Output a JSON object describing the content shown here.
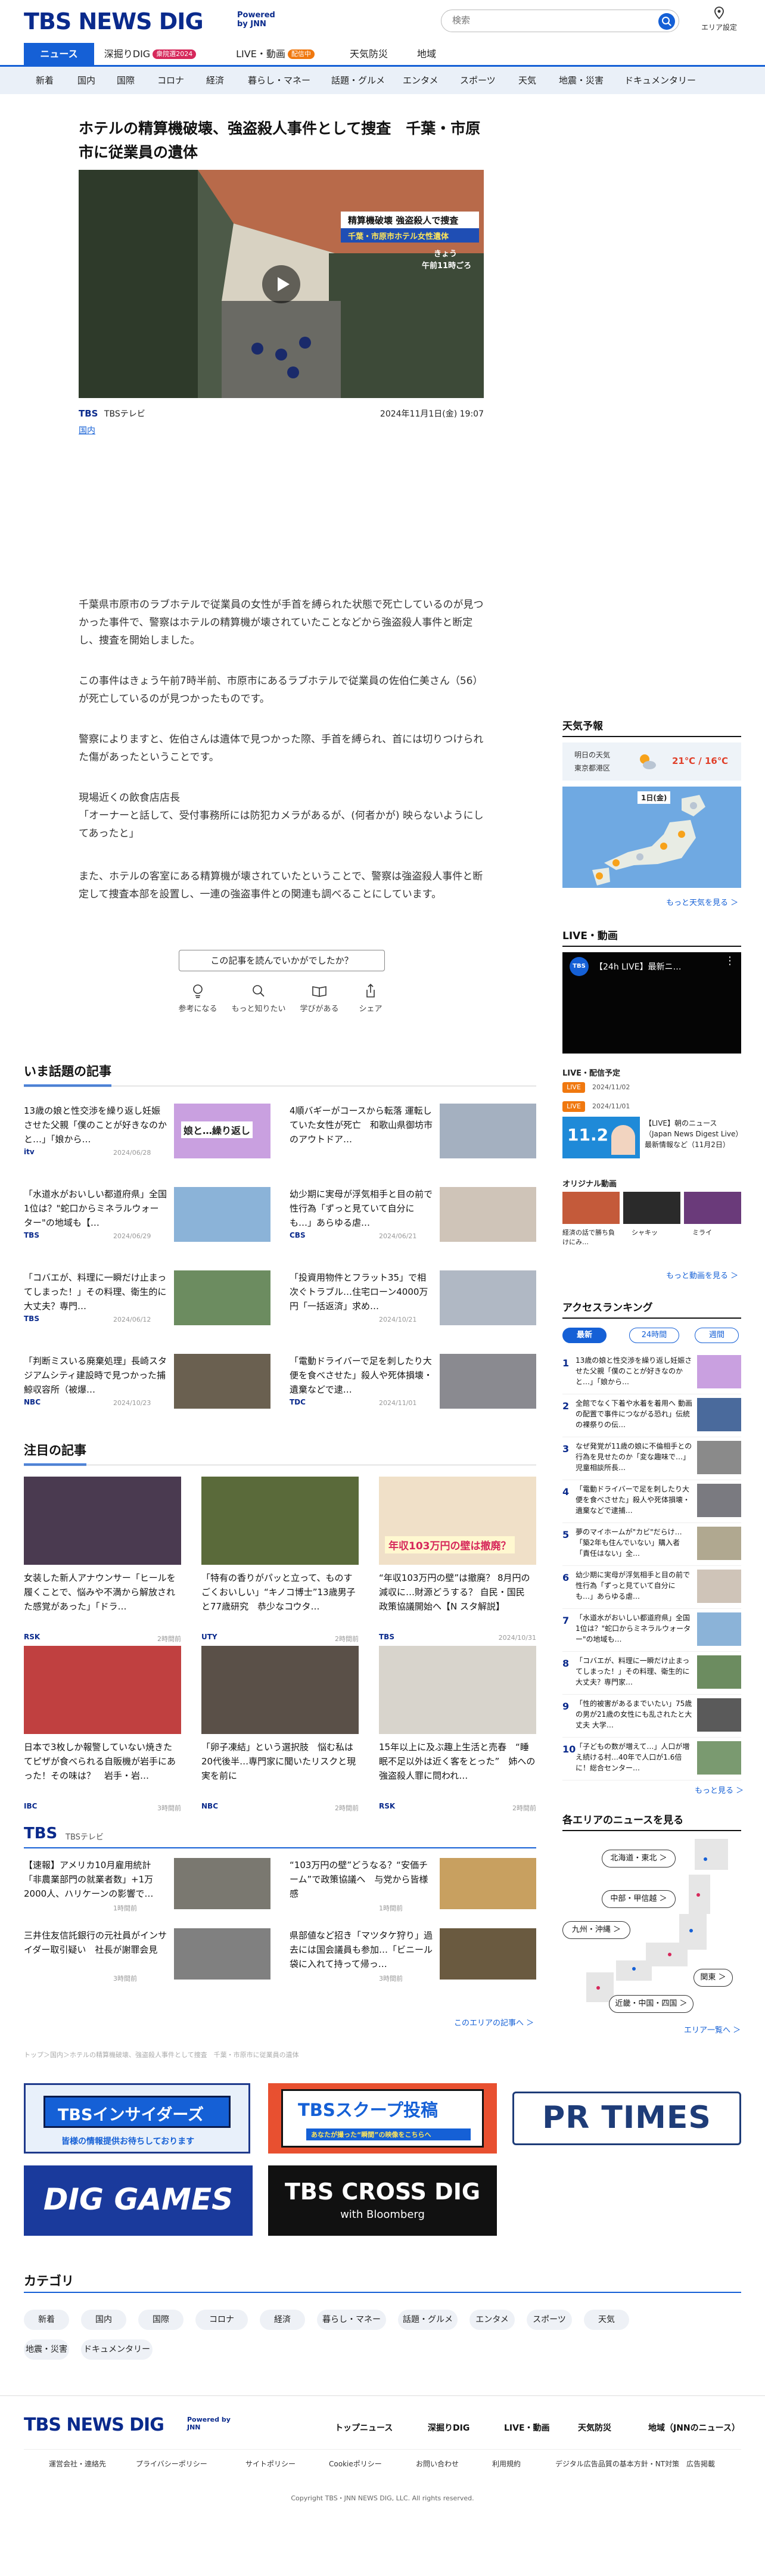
{
  "header": {
    "logo": "TBS NEWS DIG",
    "powered": "Powered by JNN",
    "search_placeholder": "検索",
    "area_setting": "エリア設定"
  },
  "global_nav": [
    {
      "label": "ニュース",
      "active": true
    },
    {
      "label": "深掘りDIG",
      "badge": "衆院選2024",
      "badge_color": "#d6285b"
    },
    {
      "label": "LIVE・動画",
      "badge": "配信中",
      "badge_color": "#f0780f"
    },
    {
      "label": "天気防災"
    },
    {
      "label": "地域"
    }
  ],
  "category_nav": [
    "新着",
    "国内",
    "国際",
    "コロナ",
    "経済",
    "暮らし・マネー",
    "話題・グルメ",
    "エンタメ",
    "スポーツ",
    "天気",
    "地震・災害",
    "ドキュメンタリー"
  ],
  "article": {
    "title": "ホテルの精算機破壊、強盗殺人事件として捜査　千葉・市原市に従業員の遺体",
    "hero_caption_1": "精算機破壊 強盗殺人で捜査",
    "hero_caption_2": "千葉・市原市ホテル女性遺体",
    "hero_caption_3": "きょう",
    "hero_caption_4": "午前11時ごろ",
    "source_mark": "TBS",
    "source": "TBSテレビ",
    "date": "2024年11月1日(金) 19:07",
    "category": "国内",
    "paragraphs": [
      "千葉県市原市のラブホテルで従業員の女性が手首を縛られた状態で死亡しているのが見つかった事件で、警察はホテルの精算機が壊されていたことなどから強盗殺人事件と断定し、捜査を開始しました。",
      "この事件はきょう午前7時半前、市原市にあるラブホテルで従業員の佐伯仁美さん（56）が死亡しているのが見つかったものです。",
      "警察によりますと、佐伯さんは遺体で見つかった際、手首を縛られ、首には切りつけられた傷があったということです。",
      "現場近くの飲食店店長\n「オーナーと話して、受付事務所には防犯カメラがあるが、(何者かが) 映らないようにしてあったと」",
      "また、ホテルの客室にある精算機が壊されていたということで、警察は強盗殺人事件と断定して捜査本部を設置し、一連の強盗事件との関連も調べることにしています。"
    ],
    "feedback_prompt": "この記事を読んでいかがでしたか？",
    "reactions": [
      "参考になる",
      "もっと知りたい",
      "学びがある",
      "シェア"
    ]
  },
  "trending": {
    "heading": "いま話題の記事",
    "items": [
      {
        "title": "13歳の娘と性交渉を繰り返し妊娠させた父親「僕のことが好きなのかと…」「娘から…",
        "source": "itv",
        "date": "2024/06/28",
        "thumb": "#c9a0e0",
        "thumb_text": "娘と…繰り返し"
      },
      {
        "title": "4順バギーがコースから転落 運転していた女性が死亡　和歌山県御坊市のアウトドア…",
        "source": "",
        "date": "",
        "thumb": "#a4b0c0"
      },
      {
        "title": "「水道水がおいしい都道府県」全国1位は？\"蛇口からミネラルウォーター\"の地域も【…",
        "source": "TBS",
        "date": "2024/06/29",
        "thumb": "#8bb3d8"
      },
      {
        "title": "幼少期に実母が浮気相手と目の前で性行為「ずっと見ていて自分にも…」あらゆる虐…",
        "source": "CBS",
        "date": "2024/06/21",
        "thumb": "#cfc4b8"
      },
      {
        "title": "「コバエが、料理に一瞬だけ止まってしまった！」その料理、衛生的に大丈夫？専門…",
        "source": "TBS",
        "date": "2024/06/12",
        "thumb": "#6c8c60"
      },
      {
        "title": "「投資用物件とフラット35」で相次ぐトラブル…住宅ローン4000万円「一括返済」求め…",
        "source": "",
        "date": "2024/10/21",
        "thumb": "#b0b8c4"
      },
      {
        "title": "「判断ミスいる廃棄処理」長崎スタジアムシティ建設時で見つかった捕鯨収容所（被爆…",
        "source": "NBC",
        "date": "2024/10/23",
        "thumb": "#6a6050"
      },
      {
        "title": "「電動ドライバーで足を刺したり大便を食べさせた」殺人や死体損壊・遺棄などで逮…",
        "source": "TDC",
        "date": "2024/11/01",
        "thumb": "#8a8a90"
      }
    ]
  },
  "featured": {
    "heading": "注目の記事",
    "items": [
      {
        "title": "女装した新人アナウンサー「ヒールを履くことで、悩みや不満から解放された感覚があった」「ドラ…",
        "source": "RSK",
        "date": "2時間前",
        "thumb": "#4a3a50"
      },
      {
        "title": "「特有の香りがパッと立って、ものすごくおいしい」“キノコ博士”13歳男子と77歳研究　恭少なコウタ…",
        "source": "UTY",
        "date": "2時間前",
        "thumb": "#5a6a3a"
      },
      {
        "title": "“年収103万円の壁”は撤廃？ 8月円の減収に…財源どうする？ 自民・国民 政策協議開始へ【N スタ解説】",
        "source": "TBS",
        "date": "2024/10/31",
        "thumb": "#f0e0c8",
        "thumb_text": "年収103万円の壁は撤廃？"
      },
      {
        "title": "日本で3枚しか報警していない焼きたてピザが食べられる自販機が岩手にあった！その味は？　岩手・岩…",
        "source": "IBC",
        "date": "3時間前",
        "thumb": "#c04040"
      },
      {
        "title": "「卵子凍結」という選択肢　悩む私は20代後半…専門家に聞いたリスクと現実を前に",
        "source": "NBC",
        "date": "2時間前",
        "thumb": "#5a5048"
      },
      {
        "title": "15年以上に及ぶ趣上生活と売春　“睡眠不足以外は近く客をとった”　姉への強盗殺人罪に問われ…",
        "source": "RSK",
        "date": "2時間前",
        "thumb": "#d8d4cc"
      }
    ]
  },
  "tbs_block": {
    "heading": "TBS",
    "sub": "TBSテレビ",
    "items": [
      {
        "title": "【速報】アメリカ10月雇用統計「非農業部門の就業者数」+1万2000人、ハリケーンの影響で…",
        "date": "1時間前",
        "thumb": "#7a7870"
      },
      {
        "title": "“103万円の壁”どうなる？“安価チーム”で政策協議へ　与党から皆様感",
        "date": "1時間前",
        "thumb": "#c8a060"
      },
      {
        "title": "三井住友信託銀行の元社員がインサイダー取引疑い　社長が謝罪会見",
        "date": "3時間前",
        "thumb": "#808080"
      },
      {
        "title": "県部値など招き「マツタケ狩り」過去には国会議員も参加…「ビニール袋に入れて持って帰っ…",
        "date": "3時間前",
        "thumb": "#6a5a40"
      }
    ],
    "more": "このエリアの記事へ ＞"
  },
  "breadcrumb": "トップ＞国内＞ホテルの精算機破壊、強盗殺人事件として捜査　千葉・市原市に従業員の遺体",
  "banners": [
    {
      "label": "TBSインサイダーズ",
      "sub": "皆様の情報提供お待ちしております",
      "bg": "#e8f0fa",
      "fg": "#1560d6"
    },
    {
      "label": "TBSスクープ投稿",
      "sub": "あなたが撮った“瞬間”の映像をこちらへ",
      "bg": "#e85030",
      "fg": "#1560d6"
    },
    {
      "label": "PR TIMES",
      "bg": "#ffffff",
      "fg": "#1e3c78"
    },
    {
      "label": "DIG GAMES",
      "bg": "#1a3a9c",
      "fg": "#ffffff"
    },
    {
      "label": "TBS CROSS DIG",
      "sub": "with Bloomberg",
      "bg": "#111111",
      "fg": "#ffffff"
    }
  ],
  "bottom_categories": {
    "heading": "カテゴリ",
    "items": [
      "新着",
      "国内",
      "国際",
      "コロナ",
      "経済",
      "暮らし・マネー",
      "話題・グルメ",
      "エンタメ",
      "スポーツ",
      "天気",
      "地震・災害",
      "ドキュメンタリー"
    ]
  },
  "sidebar": {
    "weather": {
      "heading": "天気予報",
      "city_label_1": "明日の天気",
      "city_label_2": "東京都港区",
      "temps": "21℃ / 16℃",
      "map_date": "1日(金)",
      "more": "もっと天気を見る ＞"
    },
    "live": {
      "heading": "LIVE・動画",
      "video_title": "【24h LIVE】最新ニ…",
      "schedule_heading": "LIVE・配信予定",
      "schedule_items": [
        {
          "tag": "LIVE",
          "date": "2024/11/02"
        },
        {
          "tag": "LIVE",
          "date": "2024/11/01"
        }
      ],
      "promo_date": "11.2",
      "promo_text": "【LIVE】朝のニュース（Japan News Digest Live）最新情報など（11月2日）",
      "original_heading": "オリジナル動画",
      "originals": [
        "経済の話で勝ち負けにみ…",
        "シャキッ",
        "ミライ"
      ],
      "more": "もっと動画を見る ＞"
    },
    "ranking": {
      "heading": "アクセスランキング",
      "tabs": [
        "最新",
        "24時間",
        "週間"
      ],
      "items": [
        {
          "n": "1",
          "title": "13歳の娘と性交渉を繰り返し妊娠させた父親「僕のことが好きなのかと…」「娘から…",
          "thumb": "#c9a0e0"
        },
        {
          "n": "2",
          "title": "全館でなく下着や水着を着用へ 動画の配置で事件につながる恐れ」伝統の裸祭りの伝…",
          "thumb": "#4a6a9c"
        },
        {
          "n": "3",
          "title": "なぜ発覚が11歳の娘に不倫相手との行為を見せたのか「変な趣味で…」児童相談所長…",
          "thumb": "#8a8a8a"
        },
        {
          "n": "4",
          "title": "「電動ドライバーで足を刺したり大便を食べさせた」殺人や死体損壊・遺棄などで逮捕…",
          "thumb": "#7a7a80"
        },
        {
          "n": "5",
          "title": "夢のマイホームが\"カビ\"だらけ…「築2年も住んでいない」購入者「責任はない」全…",
          "thumb": "#b0a890"
        },
        {
          "n": "6",
          "title": "幼少期に実母が浮気相手と目の前で性行為「ずっと見ていて自分にも…」あらゆる虐…",
          "thumb": "#cfc4b8"
        },
        {
          "n": "7",
          "title": "「水道水がおいしい都道府県」全国1位は？\"蛇口からミネラルウォーター\"の地域も…",
          "thumb": "#8bb3d8"
        },
        {
          "n": "8",
          "title": "「コバエが、料理に一瞬だけ止まってしまった！」その料理、衛生的に大丈夫？専門家…",
          "thumb": "#6c8c60"
        },
        {
          "n": "9",
          "title": "「性的被害があるまでいたい」75歳の男が21歳の女性にも乱されたと大丈夫 大学…",
          "thumb": "#5a5a5a"
        },
        {
          "n": "10",
          "title": "「子どもの数が増えて…」人口が増え続ける村…40年で人口が1.6倍に！総合センター…",
          "thumb": "#7a9a70"
        }
      ],
      "more": "もっと見る ＞"
    },
    "areas": {
      "heading": "各エリアのニュースを見る",
      "buttons": [
        "北海道・東北 ＞",
        "中部・甲信越 ＞",
        "九州・沖縄 ＞",
        "関東 ＞",
        "近畿・中国・四国 ＞"
      ],
      "more": "エリア一覧へ ＞"
    }
  },
  "footer": {
    "logo": "TBS NEWS DIG",
    "powered": "Powered by JNN",
    "links": [
      "トップニュース",
      "深掘りDIG",
      "LIVE・動画",
      "天気防災",
      "地域（JNNのニュース）"
    ],
    "sublinks": [
      "運営会社・連絡先",
      "プライバシーポリシー",
      "サイトポリシー",
      "Cookieポリシー",
      "お問い合わせ",
      "利用規約",
      "デジタル広告品質の基本方針・NT対策",
      "広告掲載"
    ],
    "copyright": "Copyright TBS・JNN NEWS DIG, LLC. All rights reserved."
  }
}
